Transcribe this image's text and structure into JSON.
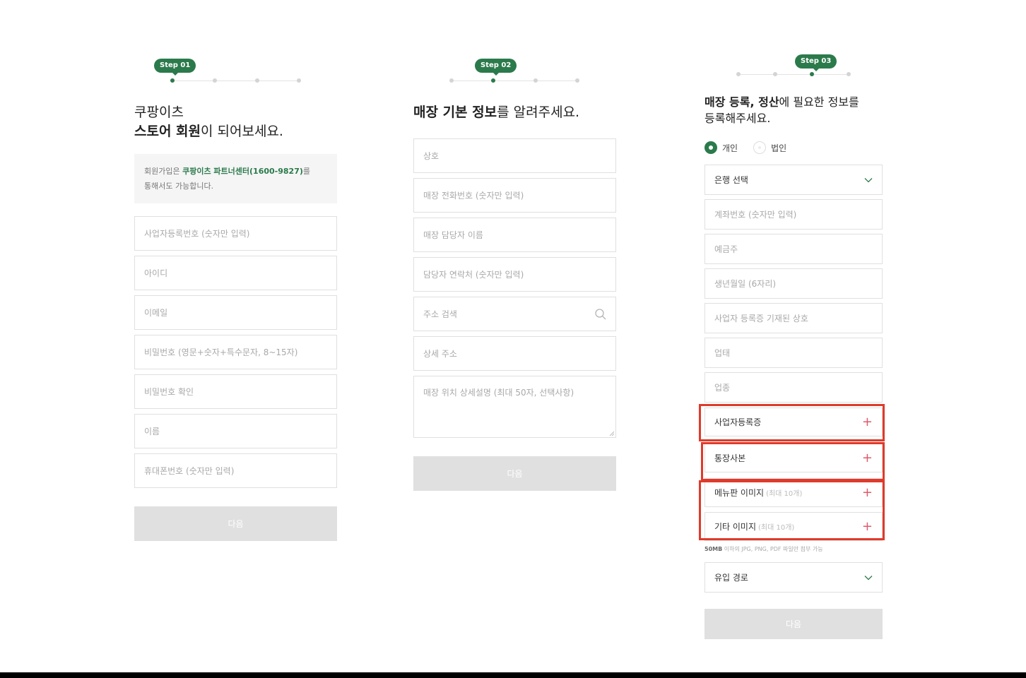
{
  "step1": {
    "badge": "Step 01",
    "heading_line1": "쿠팡이츠",
    "heading_bold": "스토어 회원",
    "heading_rest": "이 되어보세요.",
    "notice_prefix": "회원가입은 ",
    "notice_highlight": "쿠팡이츠 파트너센터(1600-9827)",
    "notice_suffix": "를",
    "notice_line2": "통해서도 가능합니다.",
    "fields": [
      "사업자등록번호 (숫자만 입력)",
      "아이디",
      "이메일",
      "비밀번호 (영문+숫자+특수문자, 8~15자)",
      "비밀번호 확인",
      "이름",
      "휴대폰번호 (숫자만 입력)"
    ],
    "next_label": "다음"
  },
  "step2": {
    "badge": "Step 02",
    "heading_bold": "매장 기본 정보",
    "heading_rest": "를 알려주세요.",
    "fields": [
      "상호",
      "매장 전화번호 (숫자만 입력)",
      "매장 담당자 이름",
      "담당자 연락처 (숫자만 입력)",
      "주소 검색",
      "상세 주소",
      "매장 위치 상세설명 (최대 50자, 선택사항)"
    ],
    "next_label": "다음"
  },
  "step3": {
    "badge": "Step 03",
    "heading_bold1": "매장 등록, 정산",
    "heading_rest1": "에 필요한 정보를",
    "heading_line2": "등록해주세요.",
    "radio_personal": "개인",
    "radio_corporate": "법인",
    "bank_select": "은행 선택",
    "fields": [
      "계좌번호 (숫자만 입력)",
      "예금주",
      "생년월일 (6자리)",
      "사업자 등록증 기재된 상호",
      "업태",
      "업종"
    ],
    "upload_business_license": "사업자등록증",
    "upload_bankbook": "통장사본",
    "upload_menu_image": "메뉴판 이미지",
    "upload_menu_image_sub": "(최대 10개)",
    "upload_other_image": "기타 이미지",
    "upload_other_image_sub": "(최대 10개)",
    "file_hint_bold": "50MB",
    "file_hint_rest": " 이하의 JPG, PNG, PDF 파일만 첨부 가능",
    "referral_select": "유입 경로",
    "next_label": "다음"
  },
  "colors": {
    "brand_green": "#2b7a4b",
    "highlight_red": "#e03a2a",
    "plus_pink": "#e05a6a",
    "button_disabled": "#e0e0e0"
  },
  "icons": {
    "search": "magnifier-icon",
    "chevron": "chevron-down-icon",
    "plus": "plus-icon"
  }
}
